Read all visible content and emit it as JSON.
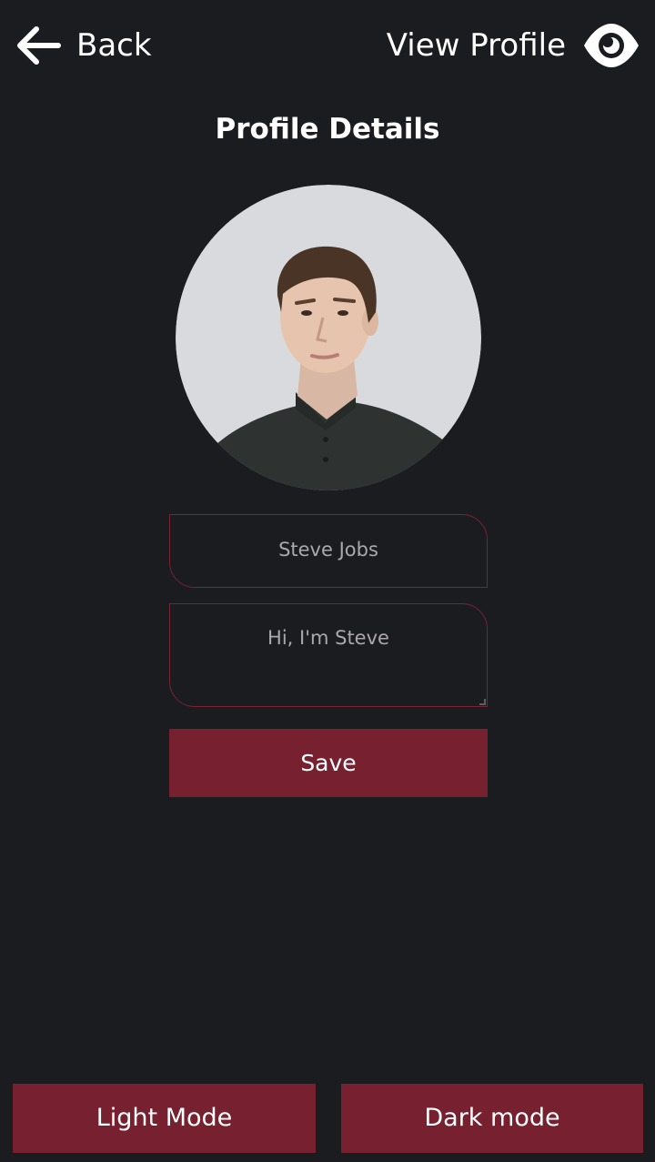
{
  "header": {
    "back_label": "Back",
    "back_icon": "arrow-left-icon",
    "view_profile_label": "View Profile",
    "view_icon": "eye-icon"
  },
  "page_title": "Profile Details",
  "profile": {
    "avatar_icon": "avatar-photo",
    "name_value": "Steve Jobs",
    "bio_value": "Hi, I'm Steve"
  },
  "actions": {
    "save_label": "Save"
  },
  "theme": {
    "light_label": "Light Mode",
    "dark_label": "Dark mode"
  },
  "colors": {
    "background": "#1b1c20",
    "accent": "#772130",
    "text": "#ffffff",
    "field_text": "#a9a9ad"
  }
}
